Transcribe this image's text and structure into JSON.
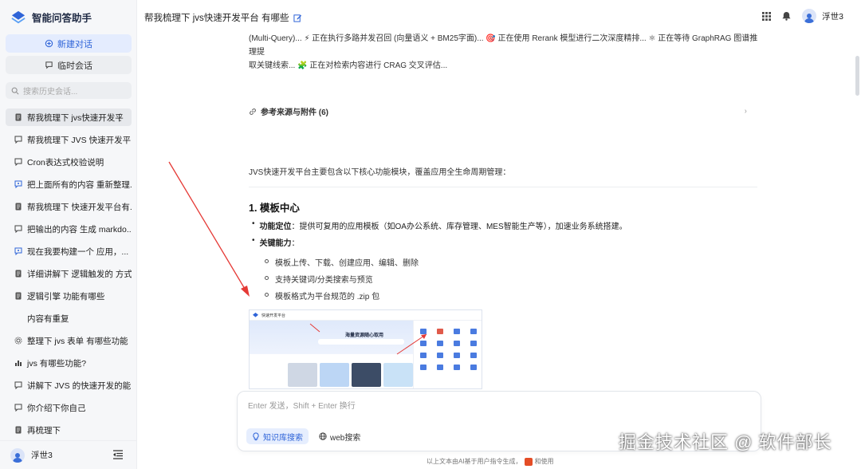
{
  "app": {
    "name": "智能问答助手"
  },
  "sidebar": {
    "new_chat": "新建对话",
    "temp_chat": "临时会话",
    "search_placeholder": "搜索历史会话...",
    "history": [
      {
        "label": "帮我梳理下 jvs快速开发平",
        "icon": "doc-icon"
      },
      {
        "label": "帮我梳理下 JVS 快速开发平...",
        "icon": "chat-icon"
      },
      {
        "label": "Cron表达式校验说明",
        "icon": "chat-icon"
      },
      {
        "label": "把上面所有的内容 重新整理...",
        "icon": "sparkle-chat-icon"
      },
      {
        "label": "帮我梳理下 快速开发平台有...",
        "icon": "doc-icon"
      },
      {
        "label": "把输出的内容 生成 markdo...",
        "icon": "chat-icon"
      },
      {
        "label": "现在我要构建一个 应用，...",
        "icon": "sparkle-chat-icon"
      },
      {
        "label": "详细讲解下 逻辑触发的 方式",
        "icon": "doc-icon"
      },
      {
        "label": "逻辑引擎 功能有哪些",
        "icon": "doc-icon"
      },
      {
        "label": "内容有重复",
        "icon": "none"
      },
      {
        "label": "整理下 jvs 表单 有哪些功能",
        "icon": "gear-icon"
      },
      {
        "label": "jvs 有哪些功能?",
        "icon": "chart-icon"
      },
      {
        "label": "讲解下 JVS 的快速开发的能...",
        "icon": "chat-icon"
      },
      {
        "label": "你介绍下你自己",
        "icon": "chat-icon"
      },
      {
        "label": "再梳理下",
        "icon": "doc-icon"
      }
    ],
    "user": "浮世3"
  },
  "header": {
    "title": "帮我梳理下 jvs快速开发平台 有哪些",
    "user": "浮世3"
  },
  "main": {
    "stream_line1": "(Multi-Query)... ⚡ 正在执行多路并发召回 (向量语义 + BM25字面)... 🎯 正在使用 Rerank 模型进行二次深度精排... ⚛ 正在等待 GraphRAG 图谱推理提",
    "stream_line2": "取关键线索... 🧩 正在对检索内容进行 CRAG 交叉评估...",
    "refs": "参考来源与附件 (6)",
    "intro": "JVS快速开发平台主要包含以下核心功能模块，覆盖应用全生命周期管理：",
    "section_title": "1. 模板中心",
    "bullet1_label": "功能定位",
    "bullet1_text": "：提供可复用的应用模板（如OA办公系统、库存管理、MES智能生产等），加速业务系统搭建。",
    "bullet2_label": "关键能力",
    "bullet2_text": "：",
    "subs": [
      "模板上传、下载、创建应用、编辑、删除",
      "支持关键词/分类搜索与预览",
      "模板格式为平台规范的 .zip 包"
    ],
    "thumb": {
      "brand": "快速开发平台",
      "hero": "海量资源随心取用"
    }
  },
  "input": {
    "placeholder": "Enter 发送，Shift + Enter 换行",
    "kb_search": "知识库搜索",
    "web_search": "web搜索"
  },
  "disclaimer_a": "以上文本由AI基于用户指令生成，",
  "disclaimer_b": "和使用",
  "watermark": "掘金技术社区 @ 软件部长",
  "colors": {
    "accent": "#2f64d8",
    "sidebar_bg": "#f6f7f9",
    "arrow": "#e53935"
  }
}
